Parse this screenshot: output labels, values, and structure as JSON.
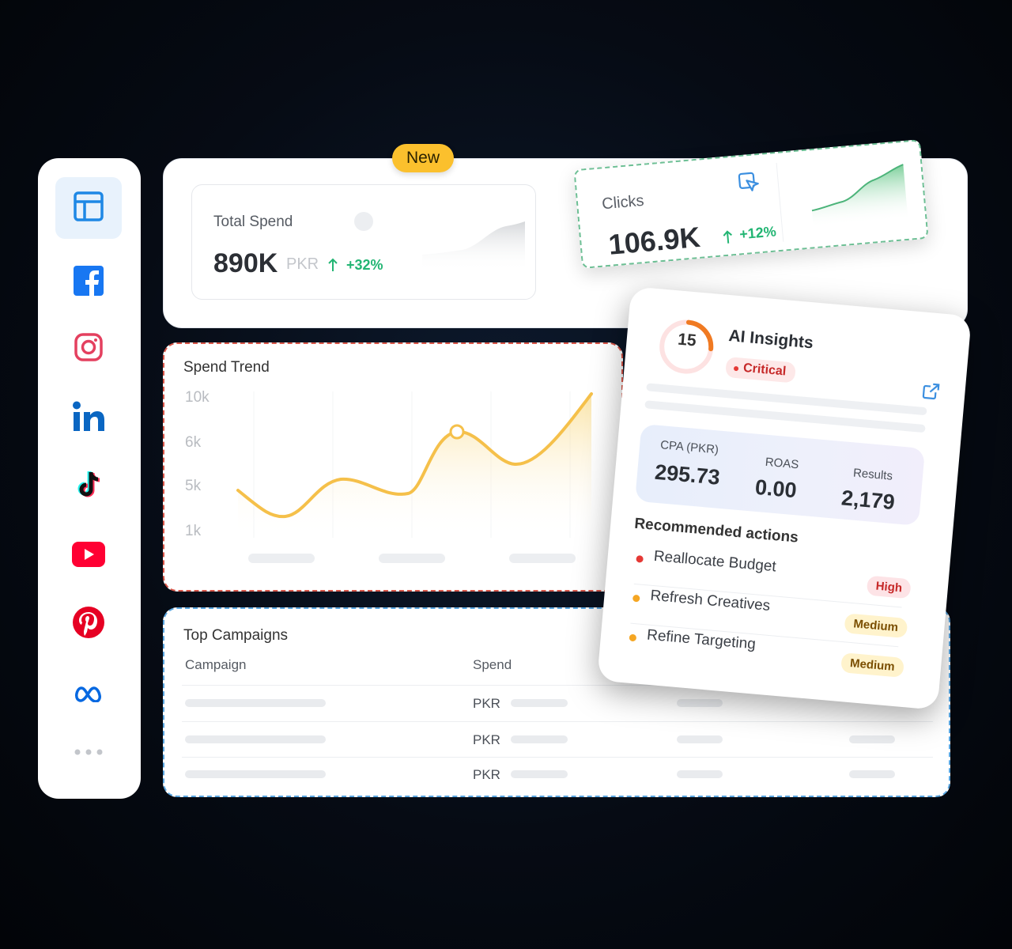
{
  "sidebar": {
    "items": [
      {
        "name": "dashboard",
        "icon": "dashboard-layout-icon",
        "color": "#1e88e5"
      },
      {
        "name": "facebook",
        "icon": "facebook-icon",
        "color": "#1877f2"
      },
      {
        "name": "instagram",
        "icon": "instagram-icon",
        "color": "#e4405f"
      },
      {
        "name": "linkedin",
        "icon": "linkedin-icon",
        "color": "#0a66c2"
      },
      {
        "name": "tiktok",
        "icon": "tiktok-icon",
        "color": "#000000"
      },
      {
        "name": "youtube",
        "icon": "youtube-icon",
        "color": "#ff0033"
      },
      {
        "name": "pinterest",
        "icon": "pinterest-icon",
        "color": "#e60023"
      },
      {
        "name": "meta",
        "icon": "meta-icon",
        "color": "#0668e1"
      },
      {
        "name": "more",
        "icon": "more-dots-icon",
        "color": "#c3c6cb"
      }
    ]
  },
  "badge": {
    "label": "New"
  },
  "total_spend": {
    "title": "Total Spend",
    "value": "890K",
    "unit": "PKR",
    "delta": "+32%"
  },
  "clicks": {
    "title": "Clicks",
    "value": "106.9K",
    "delta": "+12%"
  },
  "spend_trend": {
    "title": "Spend Trend",
    "chart_data": {
      "type": "area",
      "title": "Spend Trend",
      "y_ticks": [
        "10k",
        "6k",
        "5k",
        "1k"
      ],
      "color": "#f5c04a"
    }
  },
  "top_campaigns": {
    "title": "Top Campaigns",
    "columns": [
      "Campaign",
      "Spend"
    ],
    "rows": [
      {
        "spend_prefix": "PKR"
      },
      {
        "spend_prefix": "PKR"
      },
      {
        "spend_prefix": "PKR"
      }
    ]
  },
  "ai_insights": {
    "score": "15",
    "title": "AI Insights",
    "status": "Critical",
    "metrics": [
      {
        "label": "CPA (PKR)",
        "value": "295.73"
      },
      {
        "label": "ROAS",
        "value": "0.00"
      },
      {
        "label": "Results",
        "value": "2,179"
      }
    ],
    "recommended_title": "Recommended actions",
    "actions": [
      {
        "label": "Reallocate Budget",
        "priority": "High",
        "dot": "#e53935"
      },
      {
        "label": "Refresh Creatives",
        "priority": "Medium",
        "dot": "#f5a623"
      },
      {
        "label": "Refine Targeting",
        "priority": "Medium",
        "dot": "#f5a623"
      }
    ]
  }
}
